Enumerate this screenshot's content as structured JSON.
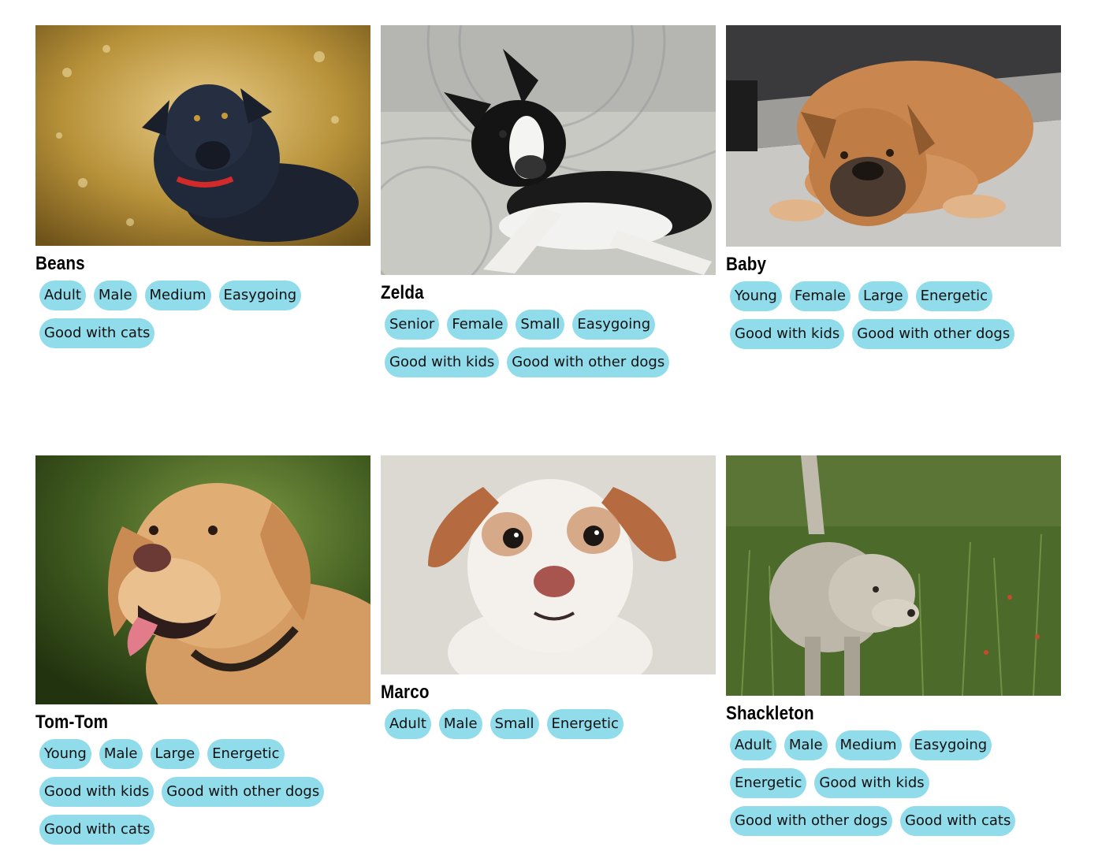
{
  "dogs": [
    {
      "name": "Beans",
      "tags": [
        "Adult",
        "Male",
        "Medium",
        "Easygoing",
        "Good with cats"
      ]
    },
    {
      "name": "Zelda",
      "tags": [
        "Senior",
        "Female",
        "Small",
        "Easygoing",
        "Good with kids",
        "Good with other dogs"
      ]
    },
    {
      "name": "Baby",
      "tags": [
        "Young",
        "Female",
        "Large",
        "Energetic",
        "Good with kids",
        "Good with other dogs"
      ]
    },
    {
      "name": "Tom-Tom",
      "tags": [
        "Young",
        "Male",
        "Large",
        "Energetic",
        "Good with kids",
        "Good with other dogs",
        "Good with cats"
      ]
    },
    {
      "name": "Marco",
      "tags": [
        "Adult",
        "Male",
        "Small",
        "Energetic"
      ]
    },
    {
      "name": "Shackleton",
      "tags": [
        "Adult",
        "Male",
        "Medium",
        "Easygoing",
        "Energetic",
        "Good with kids",
        "Good with other dogs",
        "Good with cats"
      ]
    }
  ],
  "colors": {
    "tag_background": "#90dceb",
    "page_background": "#ffffff"
  }
}
